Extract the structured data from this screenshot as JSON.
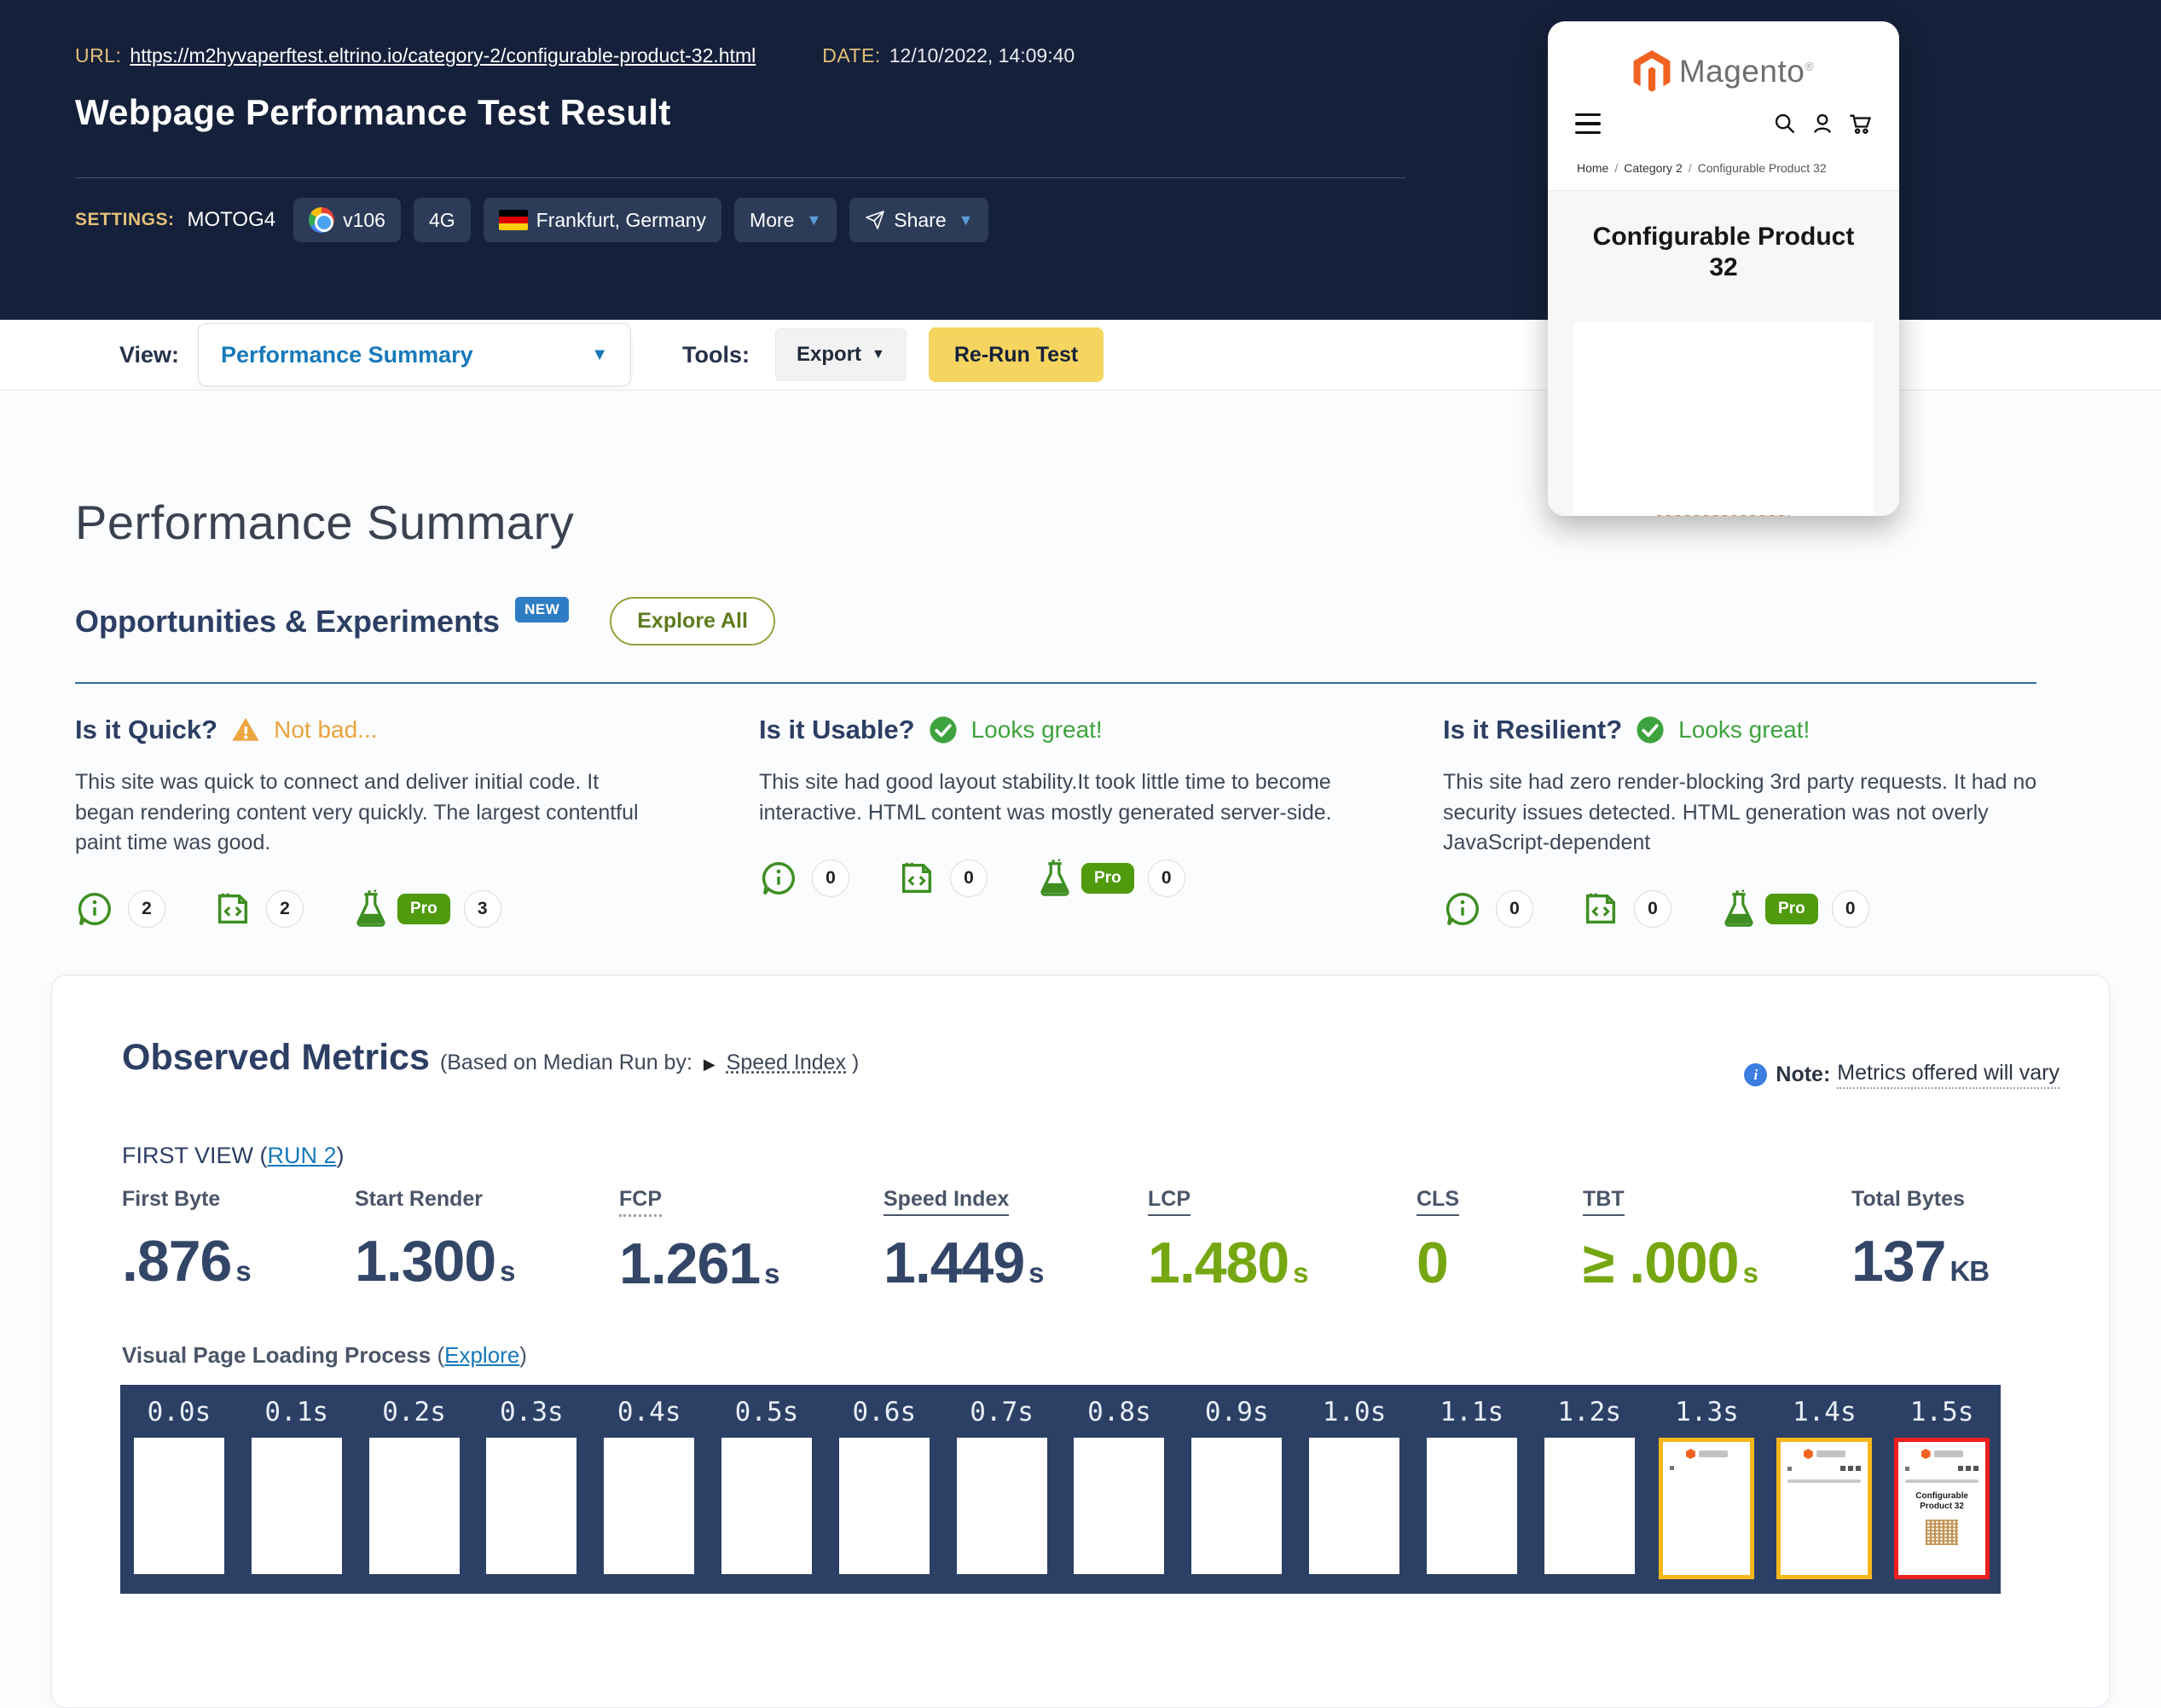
{
  "header": {
    "url_label": "URL:",
    "url": "https://m2hyvaperftest.eltrino.io/category-2/configurable-product-32.html",
    "date_label": "DATE:",
    "date": "12/10/2022, 14:09:40",
    "title": "Webpage Performance Test Result",
    "settings_label": "SETTINGS:",
    "device": "MOTOG4",
    "browser_version": "v106",
    "connection": "4G",
    "location": "Frankfurt, Germany",
    "more_label": "More",
    "share_label": "Share"
  },
  "toolbar": {
    "view_label": "View:",
    "view_value": "Performance Summary",
    "tools_label": "Tools:",
    "export_label": "Export",
    "rerun_label": "Re-Run Test"
  },
  "phone_preview": {
    "brand": "Magento",
    "breadcrumb": [
      "Home",
      "Category 2",
      "Configurable Product 32"
    ],
    "product_title": "Configurable Product 32"
  },
  "summary": {
    "title": "Performance Summary",
    "section_title": "Opportunities & Experiments",
    "new_badge": "NEW",
    "explore_all": "Explore All",
    "pro_label": "Pro",
    "cards": [
      {
        "question": "Is it Quick?",
        "status": "Not bad...",
        "status_type": "warning",
        "description": "This site was quick to connect and deliver initial code. It began rendering content very quickly. The largest contentful paint time was good.",
        "counts": {
          "observations": "2",
          "code": "2",
          "experiments": "3"
        }
      },
      {
        "question": "Is it Usable?",
        "status": "Looks great!",
        "status_type": "good",
        "description": "This site had good layout stability.It took little time to become interactive. HTML content was mostly generated server-side.",
        "counts": {
          "observations": "0",
          "code": "0",
          "experiments": "0"
        }
      },
      {
        "question": "Is it Resilient?",
        "status": "Looks great!",
        "status_type": "good",
        "description": "This site had zero render-blocking 3rd party requests. It had no security issues detected. HTML generation was not overly JavaScript-dependent",
        "counts": {
          "observations": "0",
          "code": "0",
          "experiments": "0"
        }
      }
    ]
  },
  "observed": {
    "title": "Observed Metrics",
    "subtitle_prefix": "(Based on Median Run by:",
    "speed_index_link": "Speed Index",
    "subtitle_suffix": ")",
    "note_label": "Note:",
    "note_text": "Metrics offered will vary",
    "first_view_prefix": "FIRST VIEW (",
    "run_link": "RUN 2",
    "first_view_suffix": ")",
    "metrics": [
      {
        "label": "First Byte",
        "value": ".876",
        "unit": "s",
        "color": "navy",
        "underline": "none"
      },
      {
        "label": "Start Render",
        "value": "1.300",
        "unit": "s",
        "color": "navy",
        "underline": "none"
      },
      {
        "label": "FCP",
        "value": "1.261",
        "unit": "s",
        "color": "navy",
        "underline": "dotted"
      },
      {
        "label": "Speed Index",
        "value": "1.449",
        "unit": "s",
        "color": "navy",
        "underline": "solid"
      },
      {
        "label": "LCP",
        "value": "1.480",
        "unit": "s",
        "color": "green",
        "underline": "solid"
      },
      {
        "label": "CLS",
        "value": "0",
        "unit": "",
        "color": "green",
        "underline": "solid"
      },
      {
        "label": "TBT",
        "value": "≥ .000",
        "unit": "s",
        "color": "green",
        "underline": "solid"
      },
      {
        "label": "Total Bytes",
        "value": "137",
        "unit": "KB",
        "color": "navy",
        "underline": "none"
      }
    ],
    "filmstrip_title": "Visual Page Loading Process",
    "explore_link": "Explore",
    "frames": [
      {
        "time": "0.0s",
        "stage": "blank"
      },
      {
        "time": "0.1s",
        "stage": "blank"
      },
      {
        "time": "0.2s",
        "stage": "blank"
      },
      {
        "time": "0.3s",
        "stage": "blank"
      },
      {
        "time": "0.4s",
        "stage": "blank"
      },
      {
        "time": "0.5s",
        "stage": "blank"
      },
      {
        "time": "0.6s",
        "stage": "blank"
      },
      {
        "time": "0.7s",
        "stage": "blank"
      },
      {
        "time": "0.8s",
        "stage": "blank"
      },
      {
        "time": "0.9s",
        "stage": "blank"
      },
      {
        "time": "1.0s",
        "stage": "blank"
      },
      {
        "time": "1.1s",
        "stage": "blank"
      },
      {
        "time": "1.2s",
        "stage": "blank"
      },
      {
        "time": "1.3s",
        "stage": "logo",
        "border": "#f5b71c"
      },
      {
        "time": "1.4s",
        "stage": "header",
        "border": "#f5b71c"
      },
      {
        "time": "1.5s",
        "stage": "content",
        "border": "#ee1f1f",
        "title": "Configurable Product 32"
      }
    ]
  },
  "colors": {
    "header_bg": "#15203a",
    "accent_gold": "#e3c077",
    "link_blue": "#1779ba",
    "rerun_yellow": "#f5d55f",
    "new_badge_blue": "#2e7cc3",
    "status_green": "#3ea33e",
    "status_orange": "#e9a33c",
    "icon_green": "#3e8e22",
    "pro_green": "#4f9a0d",
    "value_navy": "#334668",
    "value_green": "#76a712",
    "filmstrip_bg": "#2c4066",
    "frame_yellow": "#f5b71c",
    "frame_red": "#ee1f1f",
    "magento_orange": "#f26322"
  }
}
